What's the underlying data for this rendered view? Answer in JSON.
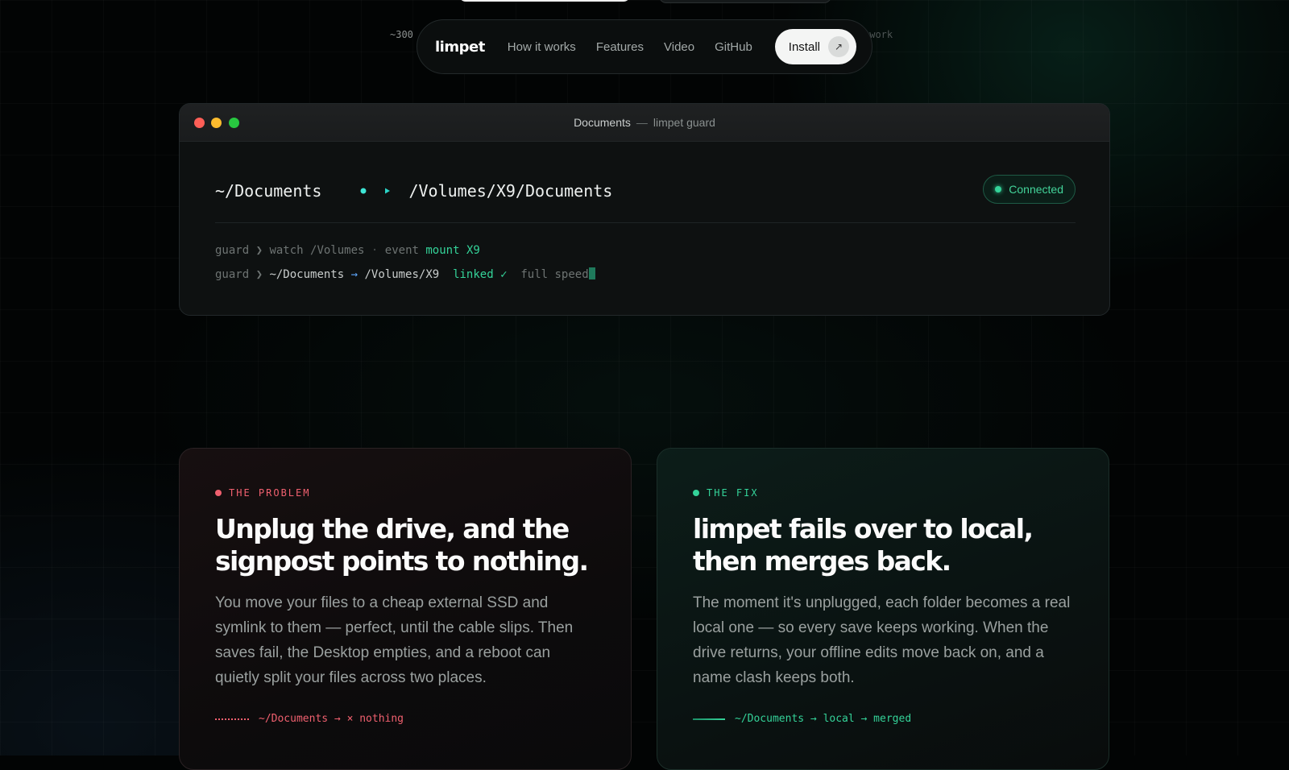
{
  "header_fragments": {
    "left": "~300",
    "right": "twork"
  },
  "nav": {
    "brand": "limpet",
    "links": [
      "How it works",
      "Features",
      "Video",
      "GitHub"
    ],
    "install_label": "Install",
    "install_icon": "arrow-up-right-icon"
  },
  "window": {
    "title": "Documents",
    "separator": "—",
    "subtitle": "limpet guard",
    "source_path": "~/Documents",
    "target_path": "/Volumes/X9/Documents",
    "status": "Connected",
    "status_color": "#34d399",
    "log": [
      {
        "prompt": "guard ❯",
        "parts": [
          "watch /Volumes",
          "·",
          "event",
          "mount X9"
        ]
      },
      {
        "prompt": "guard ❯",
        "parts": [
          "~/Documents",
          "→",
          "/Volumes/X9",
          "linked ✓",
          "full speed"
        ]
      }
    ]
  },
  "cards": {
    "problem": {
      "kicker": "THE PROBLEM",
      "headline": "Unplug the drive, and the signpost points to nothing.",
      "body": "You move your files to a cheap external SSD and symlink to them — perfect, until the cable slips. Then saves fail, the Desktop empties, and a reboot can quietly split your files across two places.",
      "footnote": "~/Documents → × nothing",
      "accent": "#f0606f"
    },
    "fix": {
      "kicker": "THE FIX",
      "headline": "limpet fails over to local, then merges back.",
      "body": "The moment it's unplugged, each folder becomes a real local one — so every save keeps working. When the drive returns, your offline edits move back on, and a name clash keeps both.",
      "footnote": "~/Documents → local → merged",
      "accent": "#34d399"
    }
  }
}
